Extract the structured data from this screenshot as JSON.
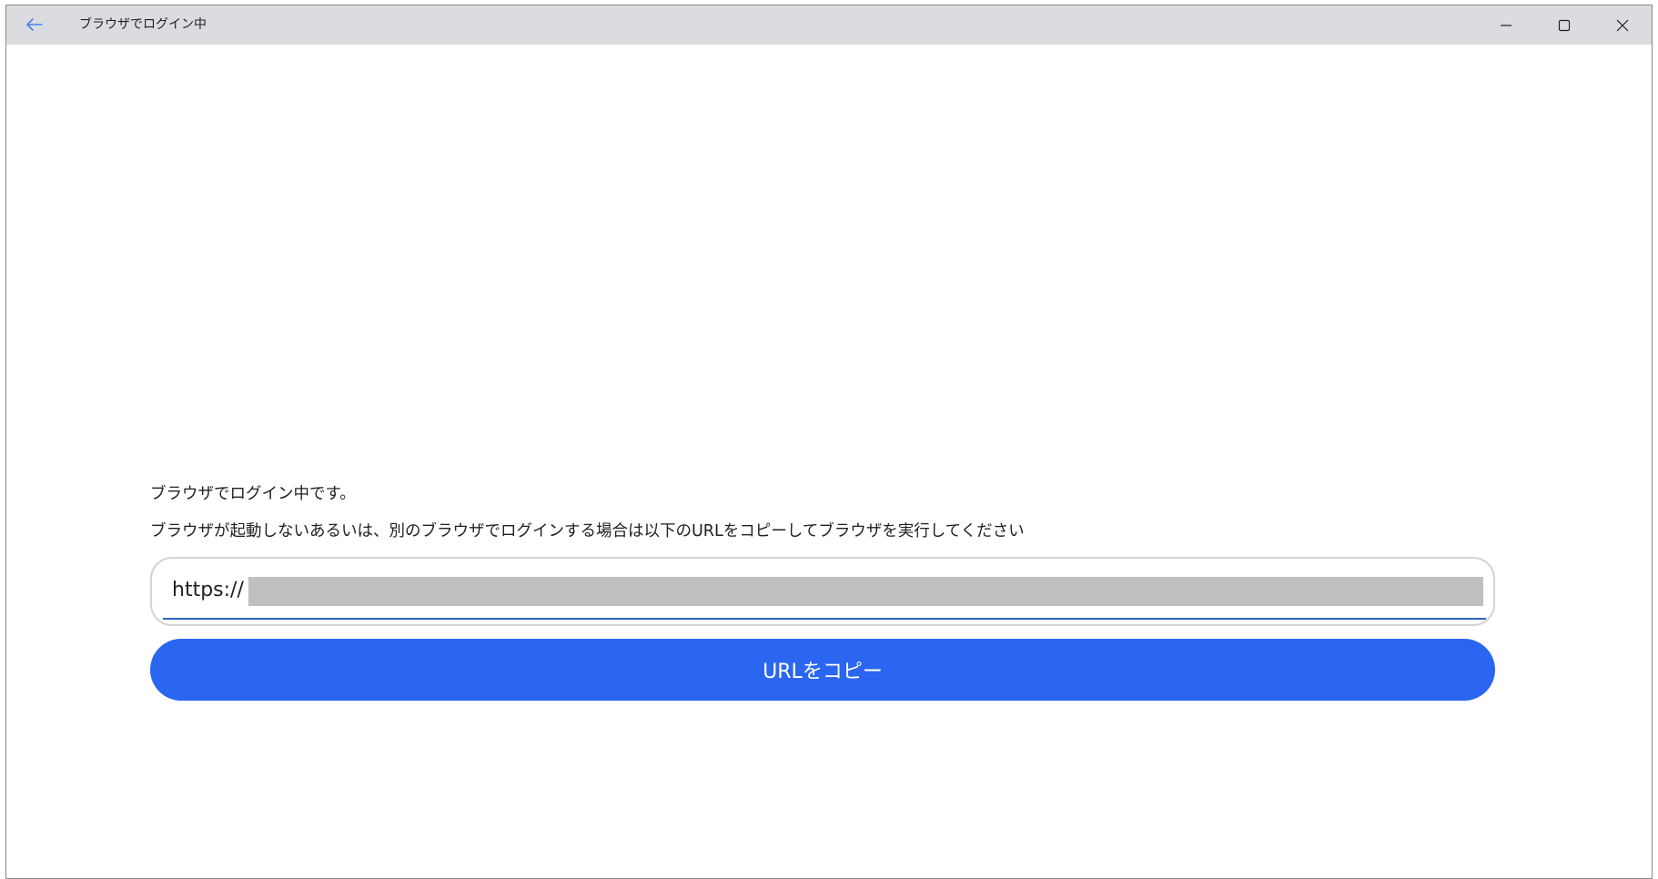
{
  "window": {
    "title": "ブラウザでログイン中",
    "back_icon": "arrow-left-icon",
    "controls": [
      "minimize-icon",
      "maximize-icon",
      "close-icon"
    ],
    "accent_color": "#4a7ff0"
  },
  "main": {
    "message1": "ブラウザでログイン中です。",
    "message2": "ブラウザが起動しないあるいは、別のブラウザでログインする場合は以下のURLをコピーしてブラウザを実行してください",
    "url_value": "https://",
    "copy_button_label": "URLをコピー",
    "button_color": "#2a66f0"
  }
}
